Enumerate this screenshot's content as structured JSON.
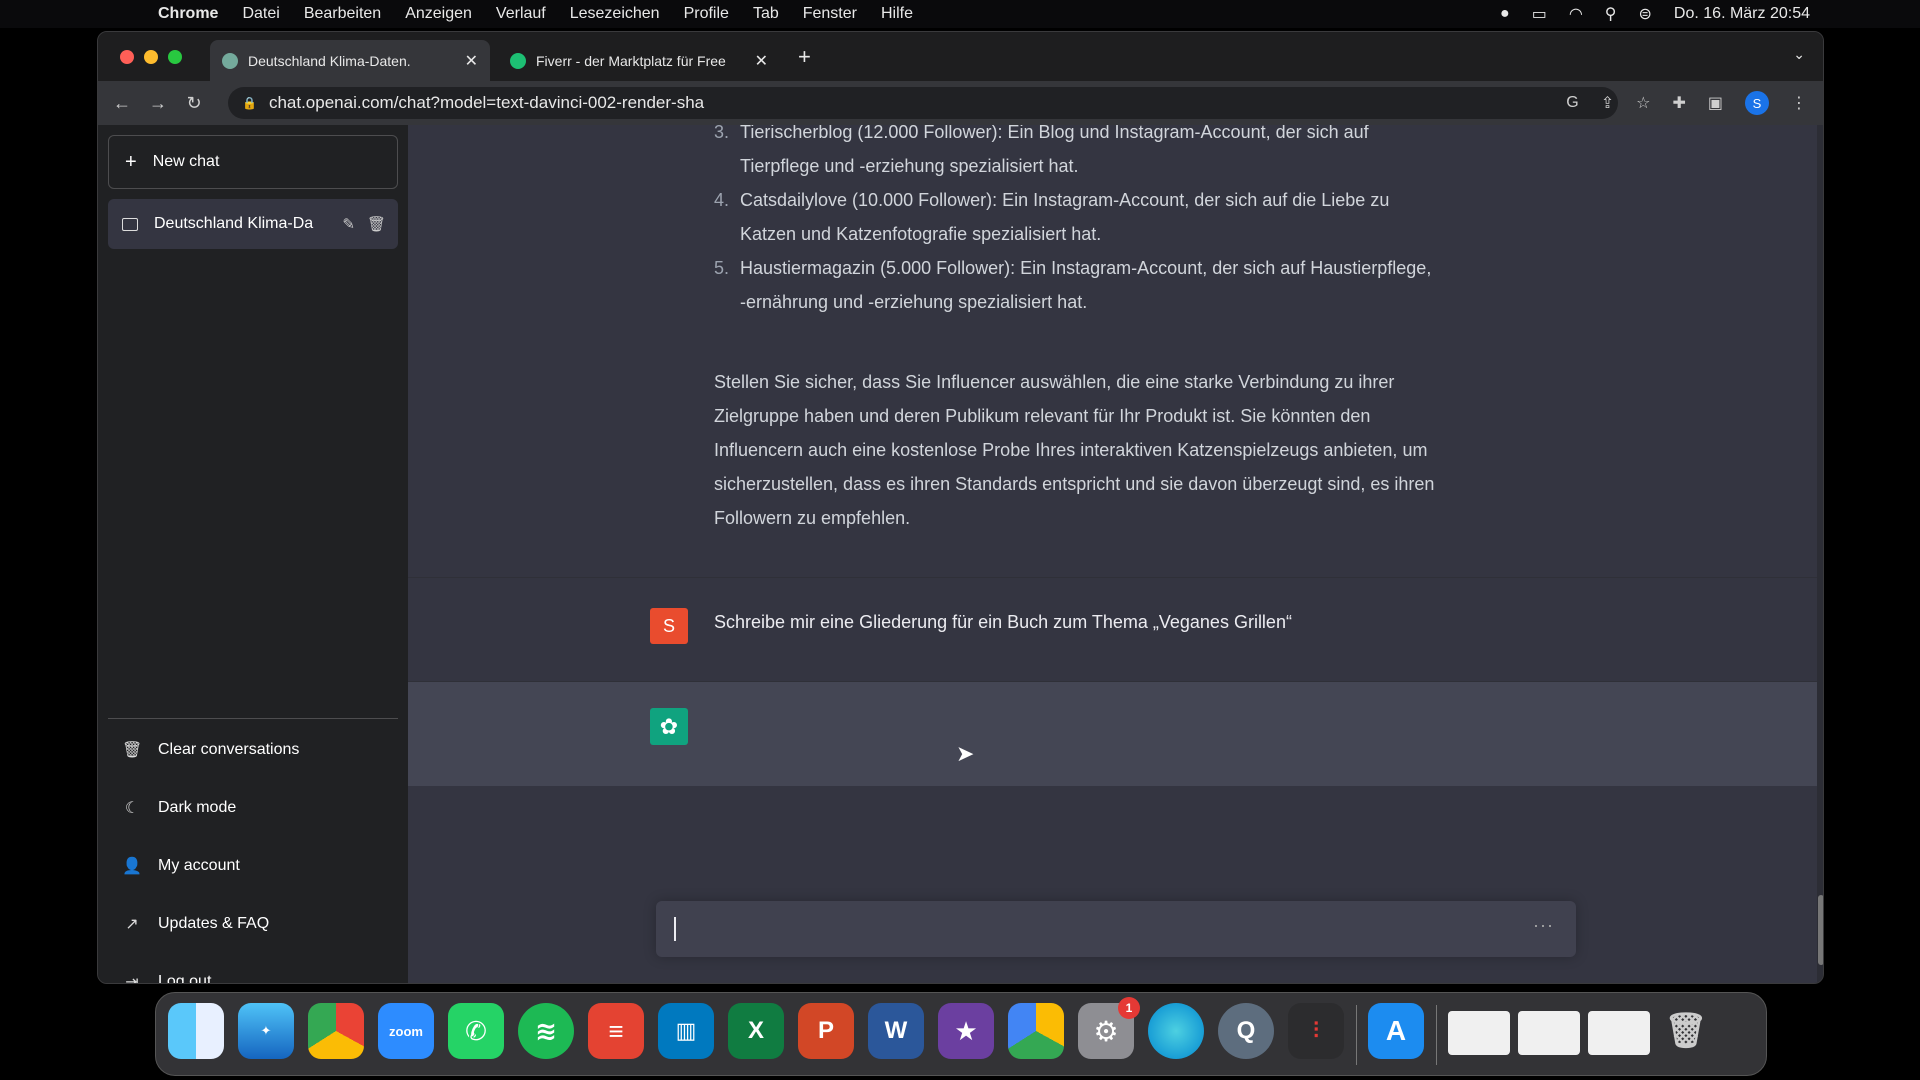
{
  "menubar": {
    "app": "Chrome",
    "items": [
      "Datei",
      "Bearbeiten",
      "Anzeigen",
      "Verlauf",
      "Lesezeichen",
      "Profile",
      "Tab",
      "Fenster",
      "Hilfe"
    ],
    "datetime": "Do. 16. März 20:54"
  },
  "browser": {
    "tabs": [
      {
        "title": "Deutschland Klima-Daten.",
        "favicon_color": "#74aa9c",
        "active": true
      },
      {
        "title": "Fiverr - der Marktplatz für Free",
        "favicon_color": "#1dbf73",
        "active": false
      }
    ],
    "url": "chat.openai.com/chat?model=text-davinci-002-render-sha",
    "profile_initial": "S"
  },
  "sidebar": {
    "new_chat_label": "New chat",
    "conversations": [
      {
        "title": "Deutschland Klima-Da"
      }
    ],
    "menu": [
      {
        "label": "Clear conversations",
        "icon": "trash-icon"
      },
      {
        "label": "Dark mode",
        "icon": "moon-icon"
      },
      {
        "label": "My account",
        "icon": "user-icon"
      },
      {
        "label": "Updates & FAQ",
        "icon": "external-link-icon"
      },
      {
        "label": "Log out",
        "icon": "logout-icon"
      }
    ]
  },
  "chat": {
    "list_items": [
      {
        "num": "3.",
        "lines": [
          "Tierischerblog (12.000 Follower): Ein Blog und Instagram-Account, der sich auf",
          "Tierpflege und -erziehung spezialisiert hat."
        ]
      },
      {
        "num": "4.",
        "lines": [
          "Catsdailylove (10.000 Follower): Ein Instagram-Account, der sich auf die Liebe zu",
          "Katzen und Katzenfotografie spezialisiert hat."
        ]
      },
      {
        "num": "5.",
        "lines": [
          "Haustiermagazin (5.000 Follower): Ein Instagram-Account, der sich auf Haustierpflege,",
          "-ernährung und -erziehung spezialisiert hat."
        ]
      }
    ],
    "paragraph_lines": [
      "Stellen Sie sicher, dass Sie Influencer auswählen, die eine starke Verbindung zu ihrer",
      "Zielgruppe haben und deren Publikum relevant für Ihr Produkt ist. Sie könnten den",
      "Influencern auch eine kostenlose Probe Ihres interaktiven Katzenspielzeugs anbieten, um",
      "sicherzustellen, dass es ihren Standards entspricht und sie davon überzeugt sind, es ihren",
      "Followern zu empfehlen."
    ],
    "user_initial": "S",
    "user_message": "Schreibe mir eine Gliederung für ein Buch zum Thema „Veganes Grillen“",
    "input_more": "···"
  },
  "dock": {
    "zoom_label": "zoom",
    "settings_badge": "1"
  }
}
